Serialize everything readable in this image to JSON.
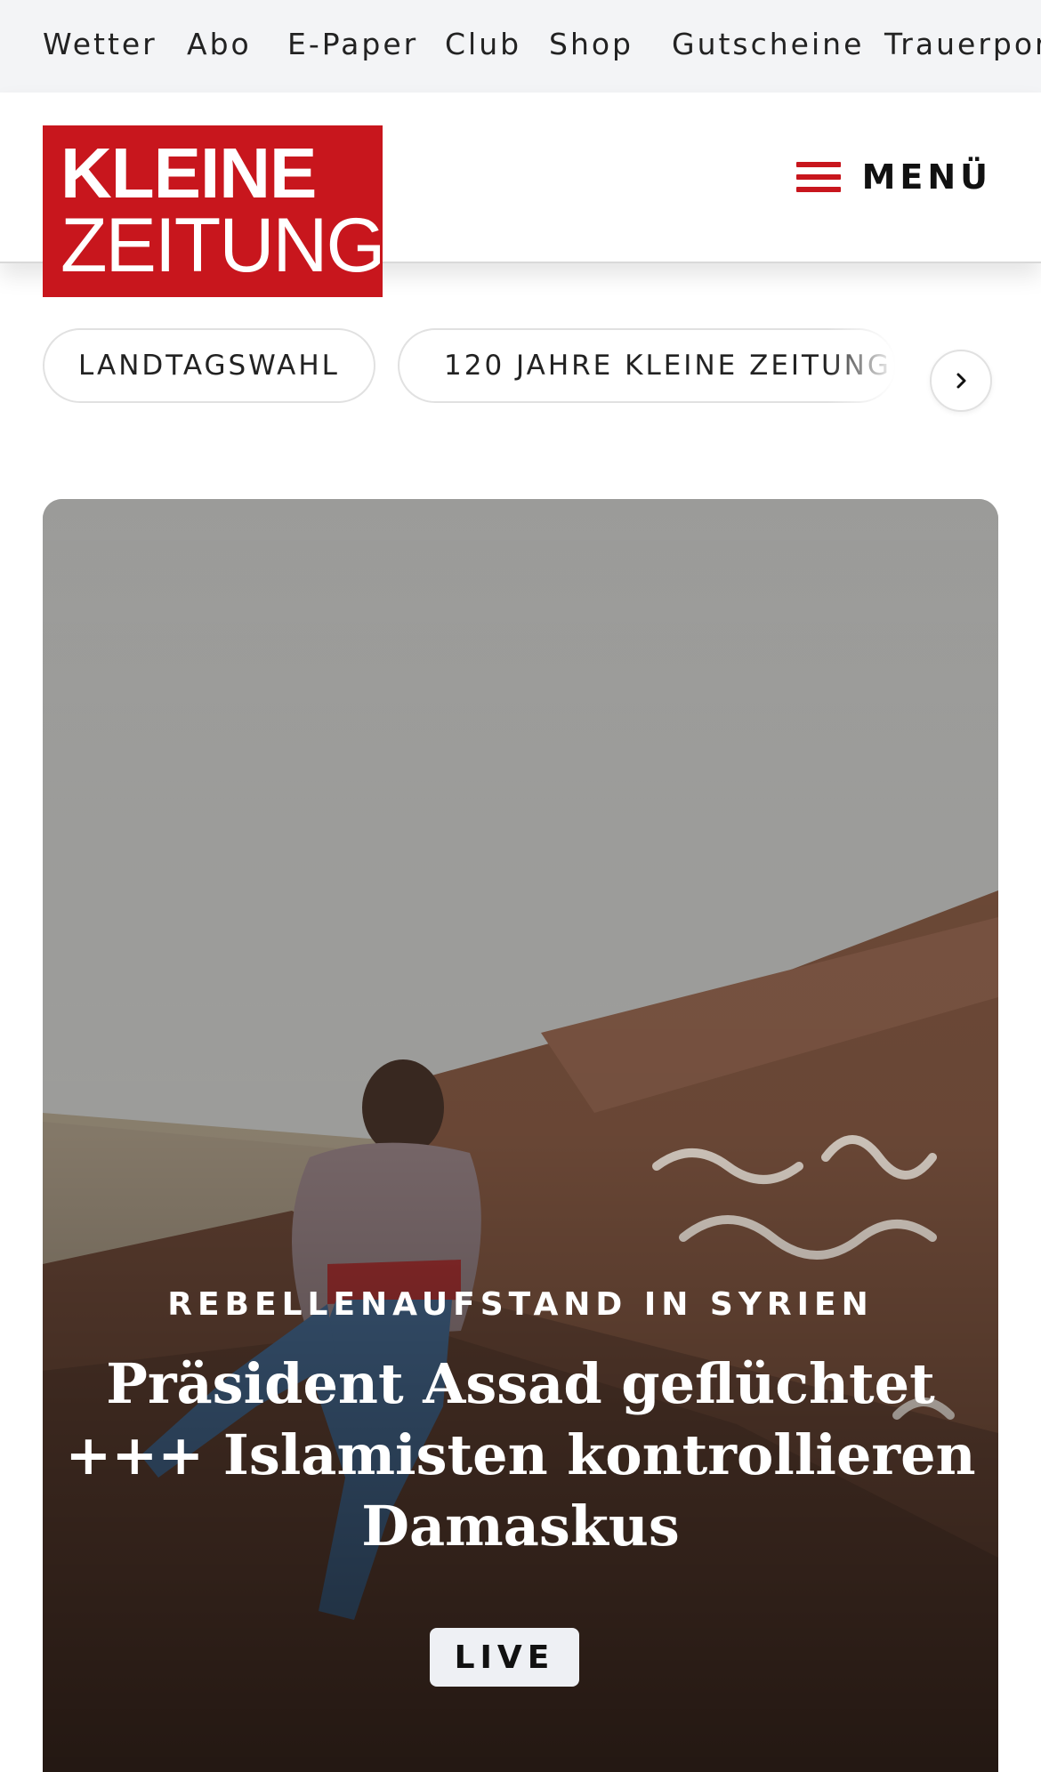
{
  "topnav": {
    "items": [
      "Wetter",
      "Abo",
      "E-Paper",
      "Club",
      "Shop",
      "Gutscheine",
      "Trauerportal"
    ]
  },
  "header": {
    "logo_line1": "KLEINE",
    "logo_line2": "ZEITUNG",
    "menu_label": "MENÜ",
    "brand_color": "#c8161d"
  },
  "topics": {
    "items": [
      "LANDTAGSWAHL",
      "120 JAHRE KLEINE ZEITUNG"
    ],
    "next_icon": "chevron-right-icon"
  },
  "hero": {
    "kicker": "REBELLENAUFSTAND IN SYRIEN",
    "title": "Präsident Assad geflüchtet +++ Islamisten kontrollieren Damaskus",
    "badge": "LIVE"
  }
}
